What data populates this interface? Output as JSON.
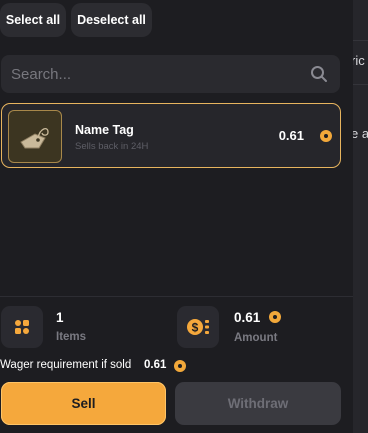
{
  "toolbar": {
    "select_all_label": "Select all",
    "deselect_all_label": "Deselect all"
  },
  "search": {
    "placeholder": "Search...",
    "value": "",
    "icon": "search-icon"
  },
  "right_peek": {
    "text_1": "ric",
    "text_2": "e a"
  },
  "items": [
    {
      "name": "Name Tag",
      "subtitle": "Sells back in 24H",
      "price": "0.61",
      "icon": "name-tag-icon",
      "selected": true
    }
  ],
  "summary": {
    "items_count": "1",
    "items_label": "Items",
    "amount_value": "0.61",
    "amount_label": "Amount",
    "wager_label": "Wager requirement if sold",
    "wager_value": "0.61"
  },
  "actions": {
    "sell_label": "Sell",
    "withdraw_label": "Withdraw"
  },
  "colors": {
    "accent": "#f5a83c",
    "selected_border": "#e7b45e",
    "background": "#1d1d21",
    "disabled": "#3a3a40"
  }
}
